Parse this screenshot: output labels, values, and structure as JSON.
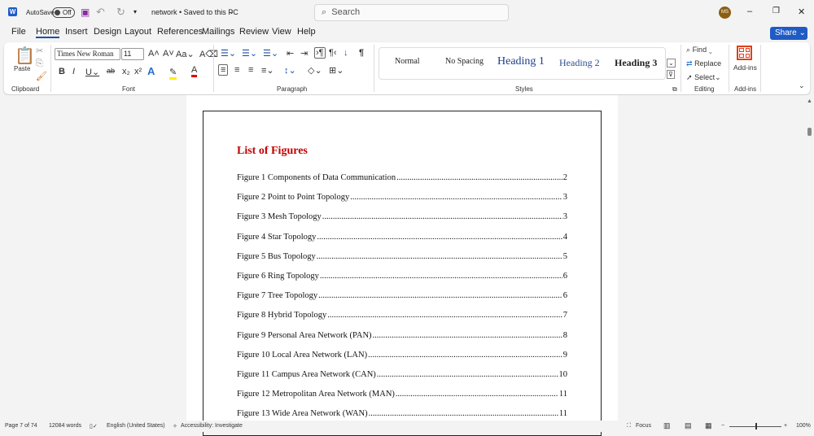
{
  "titlebar": {
    "autosave_label": "AutoSave",
    "autosave_state": "Off",
    "doc_title": "network • Saved to this PC",
    "search_placeholder": "Search",
    "avatar_initials": "MS"
  },
  "tabs": [
    "File",
    "Home",
    "Insert",
    "Design",
    "Layout",
    "References",
    "Mailings",
    "Review",
    "View",
    "Help"
  ],
  "share_label": "Share",
  "ribbon": {
    "clipboard": {
      "paste": "Paste",
      "group": "Clipboard"
    },
    "font": {
      "name": "Times New Roman",
      "size": "11",
      "group": "Font"
    },
    "paragraph": {
      "group": "Paragraph"
    },
    "styles": {
      "items": [
        "Normal",
        "No Spacing",
        "Heading 1",
        "Heading 2",
        "Heading 3"
      ],
      "group": "Styles"
    },
    "editing": {
      "find": "Find",
      "replace": "Replace",
      "select": "Select",
      "group": "Editing"
    },
    "addins": {
      "label": "Add-ins",
      "group": "Add-ins"
    }
  },
  "document": {
    "title": "List of Figures",
    "title_color": "#c00000",
    "entries": [
      {
        "text": "Figure 1 Components of Data Communication",
        "page": "2"
      },
      {
        "text": "Figure 2 Point to Point Topology",
        "page": "3"
      },
      {
        "text": "Figure 3 Mesh Topology",
        "page": "3"
      },
      {
        "text": "Figure 4 Star Topology",
        "page": "4"
      },
      {
        "text": "Figure 5 Bus Topology",
        "page": "5"
      },
      {
        "text": "Figure 6 Ring Topology",
        "page": "6"
      },
      {
        "text": "Figure 7 Tree Topology",
        "page": "6"
      },
      {
        "text": "Figure 8 Hybrid Topology",
        "page": "7"
      },
      {
        "text": "Figure 9 Personal Area Network (PAN)",
        "page": "8"
      },
      {
        "text": "Figure 10 Local Area Network (LAN)",
        "page": "9"
      },
      {
        "text": "Figure 11 Campus Area Network (CAN)",
        "page": "10"
      },
      {
        "text": "Figure 12 Metropolitan Area Network (MAN)",
        "page": "11"
      },
      {
        "text": "Figure 13 Wide Area Network (WAN)",
        "page": "11"
      }
    ]
  },
  "status": {
    "page": "Page 7 of 74",
    "words": "12084 words",
    "language": "English (United States)",
    "accessibility": "Accessibility: Investigate",
    "focus": "Focus",
    "zoom": "100%",
    "zoom_level_percent": 100
  }
}
